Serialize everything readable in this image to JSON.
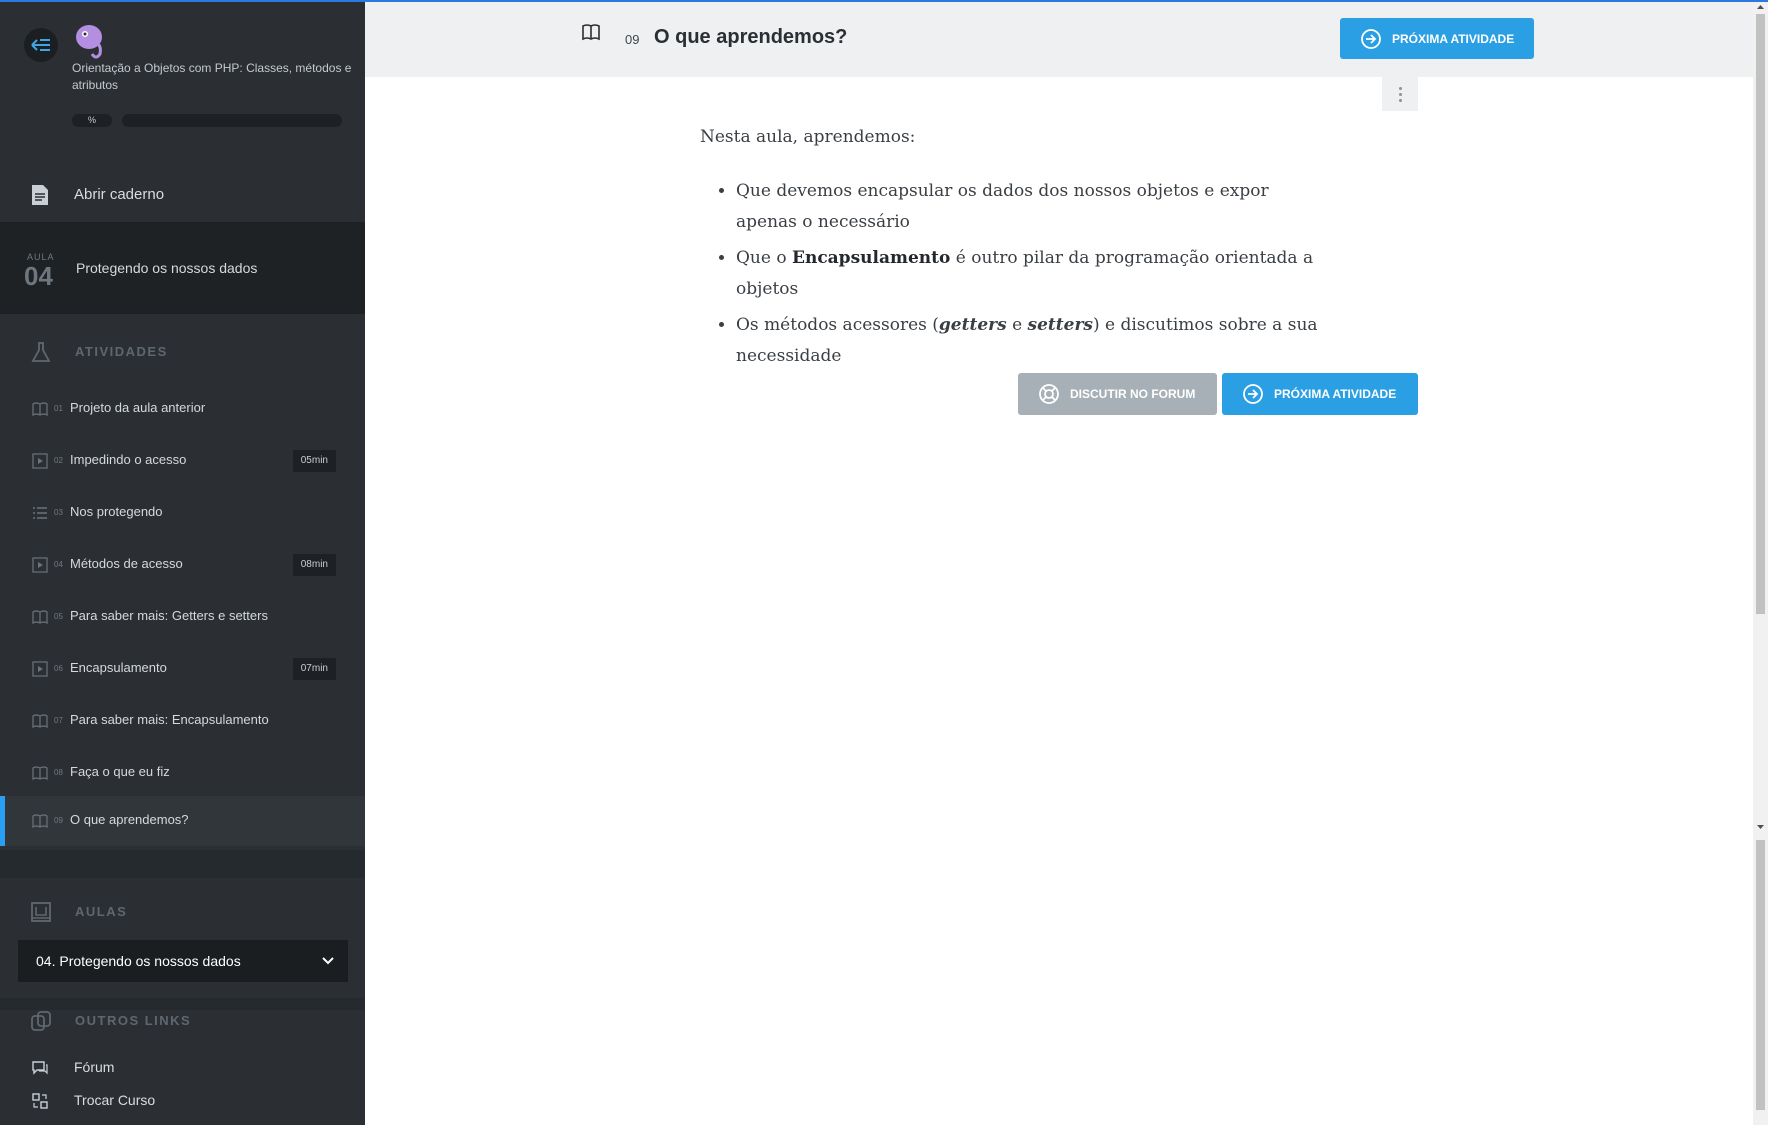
{
  "sidebar": {
    "course_title": "Orientação a Objetos com PHP: Classes, métodos e atributos",
    "progress_label": "%",
    "progress_value": 0,
    "notebook_label": "Abrir caderno",
    "lesson": {
      "aula_label": "AULA",
      "aula_number": "04",
      "title": "Protegendo os nossos dados"
    },
    "activities_header": "ATIVIDADES",
    "activities": [
      {
        "num": "01",
        "label": "Projeto da aula anterior",
        "icon": "book-icon",
        "duration": ""
      },
      {
        "num": "02",
        "label": "Impedindo o acesso",
        "icon": "video-icon",
        "duration": "05min"
      },
      {
        "num": "03",
        "label": "Nos protegendo",
        "icon": "list-icon",
        "duration": ""
      },
      {
        "num": "04",
        "label": "Métodos de acesso",
        "icon": "video-icon",
        "duration": "08min"
      },
      {
        "num": "05",
        "label": "Para saber mais: Getters e setters",
        "icon": "book-icon",
        "duration": ""
      },
      {
        "num": "06",
        "label": "Encapsulamento",
        "icon": "video-icon",
        "duration": "07min"
      },
      {
        "num": "07",
        "label": "Para saber mais: Encapsulamento",
        "icon": "book-icon",
        "duration": ""
      },
      {
        "num": "08",
        "label": "Faça o que eu fiz",
        "icon": "book-icon",
        "duration": ""
      },
      {
        "num": "09",
        "label": "O que aprendemos?",
        "icon": "book-icon",
        "duration": ""
      }
    ],
    "aulas_header": "AULAS",
    "aulas_selected": "04. Protegendo os nossos dados",
    "outros_header": "OUTROS LINKS",
    "links": [
      {
        "label": "Fórum",
        "icon": "chat-icon"
      },
      {
        "label": "Trocar Curso",
        "icon": "switch-icon"
      }
    ]
  },
  "topbar": {
    "number": "09",
    "title": "O que aprendemos?",
    "next_button": "PRÓXIMA ATIVIDADE"
  },
  "content": {
    "intro": "Nesta aula, aprendemos:",
    "item1": "Que devemos encapsular os dados dos nossos objetos e expor apenas o necessário",
    "item2_pre": "Que o ",
    "item2_bold": "Encapsulamento",
    "item2_post": " é outro pilar da programação orientada a objetos",
    "item3_pre": "Os métodos acessores (",
    "item3_i1": "getters",
    "item3_mid": " e ",
    "item3_i2": "setters",
    "item3_post": ") e discutimos sobre a sua necessidade"
  },
  "actions": {
    "forum_button": "DISCUTIR NO FORUM",
    "next_button": "PRÓXIMA ATIVIDADE"
  },
  "colors": {
    "sidebar_bg": "#2b2f33",
    "accent": "#2b9fe3",
    "forum_button": "#a7b0b7"
  }
}
